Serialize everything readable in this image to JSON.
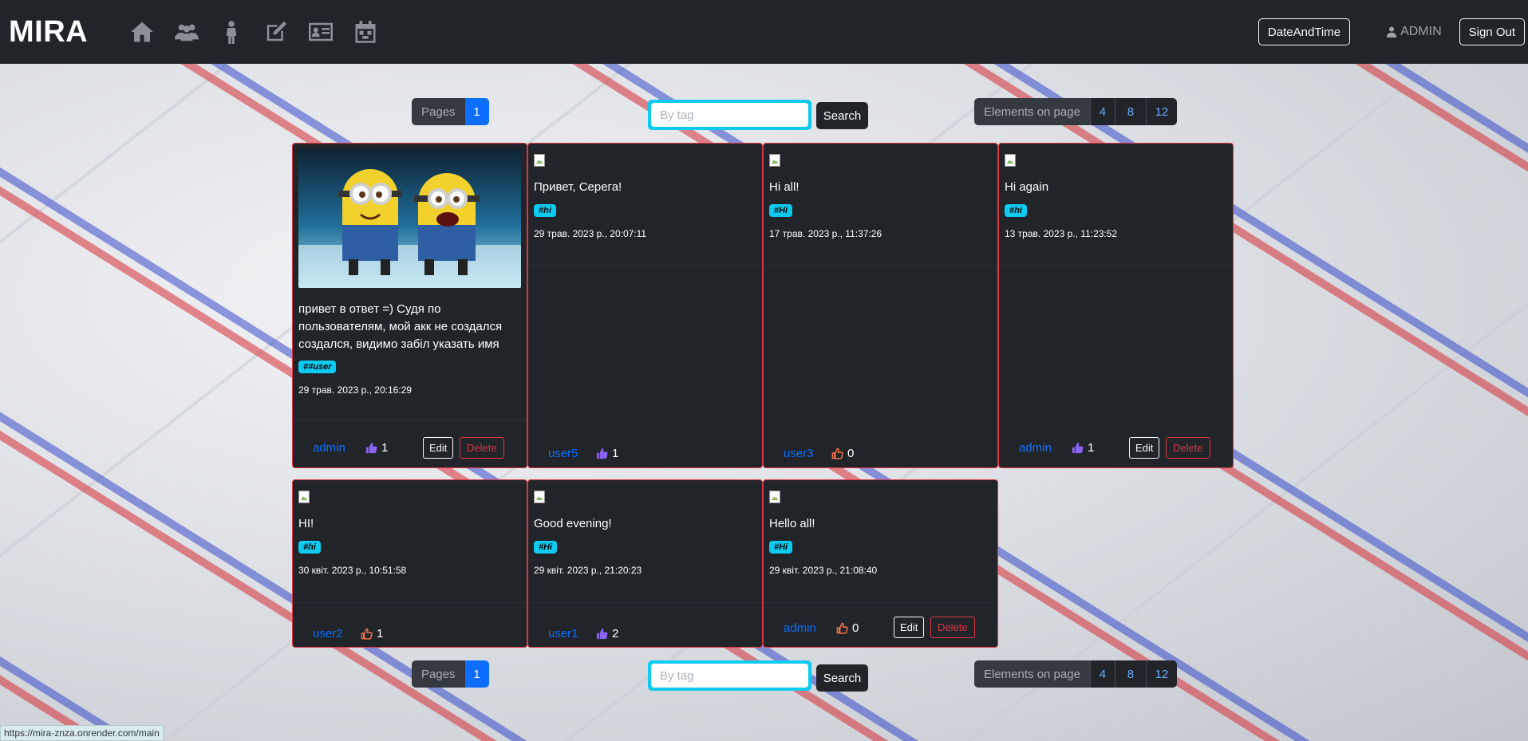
{
  "navbar": {
    "brand": "MIRA",
    "icons": [
      "home-icon",
      "users-icon",
      "person-icon",
      "edit-icon",
      "id-card-icon",
      "calendar-icon"
    ],
    "date_button": "DateAndTime",
    "user_label": "ADMIN",
    "signout_button": "Sign Out"
  },
  "controls": {
    "pages_label": "Pages",
    "current_page": "1",
    "search_placeholder": "By tag",
    "search_button": "Search",
    "elements_label": "Elements on page",
    "elements_options": [
      "4",
      "8",
      "12"
    ]
  },
  "posts": [
    {
      "text": "привет в ответ =) Судя по пользователям, мой акк не создался создался, видимо забіл указать имя",
      "tag": "##user",
      "date": "29 трав. 2023 р., 20:16:29",
      "author": "admin",
      "likes": "1",
      "reaction": "like",
      "editable": true,
      "edit": "Edit",
      "delete": "Delete",
      "has_image": true
    },
    {
      "text": "Привет, Серега!",
      "tag": "#hi",
      "date": "29 трав. 2023 р., 20:07:11",
      "author": "user5",
      "likes": "1",
      "reaction": "like",
      "editable": false
    },
    {
      "text": "Hi all!",
      "tag": "#Hi",
      "date": "17 трав. 2023 р., 11:37:26",
      "author": "user3",
      "likes": "0",
      "reaction": "dislike",
      "editable": false
    },
    {
      "text": "Hi again",
      "tag": "#hi",
      "date": "13 трав. 2023 р., 11:23:52",
      "author": "admin",
      "likes": "1",
      "reaction": "like",
      "editable": true,
      "edit": "Edit",
      "delete": "Delete"
    },
    {
      "text": "HI!",
      "tag": "#hi",
      "date": "30 квіт. 2023 р., 10:51:58",
      "author": "user2",
      "likes": "1",
      "reaction": "dislike",
      "editable": false
    },
    {
      "text": "Good evening!",
      "tag": "#Hi",
      "date": "29 квіт. 2023 р., 21:20:23",
      "author": "user1",
      "likes": "2",
      "reaction": "like",
      "editable": false
    },
    {
      "text": "Hello all!",
      "tag": "#Hi",
      "date": "29 квіт. 2023 р., 21:08:40",
      "author": "admin",
      "likes": "0",
      "reaction": "dislike",
      "editable": true,
      "edit": "Edit",
      "delete": "Delete"
    }
  ],
  "status_url": "https://mira-znza.onrender.com/main",
  "colors": {
    "like": "#8a63f5",
    "dislike": "#f0704a",
    "accent": "#0dcaf0",
    "danger": "#dc3545",
    "primary": "#0d6efd"
  }
}
